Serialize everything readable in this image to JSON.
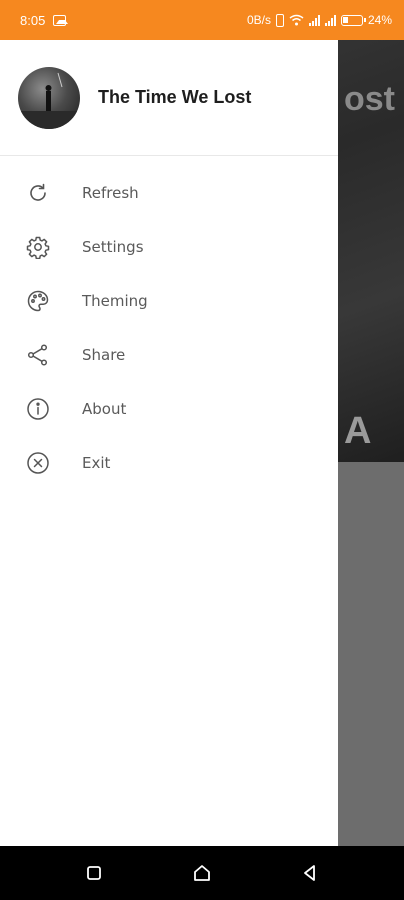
{
  "status_bar": {
    "time": "8:05",
    "network_speed": "0B/s",
    "battery": "24%",
    "icons": [
      "image-icon",
      "phone-icon",
      "wifi-icon",
      "signal-icon",
      "battery-icon"
    ]
  },
  "background": {
    "title_fragment": "ost",
    "letter_fragment": "A"
  },
  "drawer": {
    "title": "The Time We Lost",
    "items": [
      {
        "label": "Refresh",
        "icon": "refresh-icon"
      },
      {
        "label": "Settings",
        "icon": "gear-icon"
      },
      {
        "label": "Theming",
        "icon": "palette-icon"
      },
      {
        "label": "Share",
        "icon": "share-icon"
      },
      {
        "label": "About",
        "icon": "info-icon"
      },
      {
        "label": "Exit",
        "icon": "close-circle-icon"
      }
    ]
  },
  "nav_bar": {
    "buttons": [
      "recent-apps-icon",
      "home-icon",
      "back-icon"
    ]
  },
  "colors": {
    "status_bar": "#f6881f",
    "drawer_bg": "#ffffff",
    "icon": "#555555"
  }
}
